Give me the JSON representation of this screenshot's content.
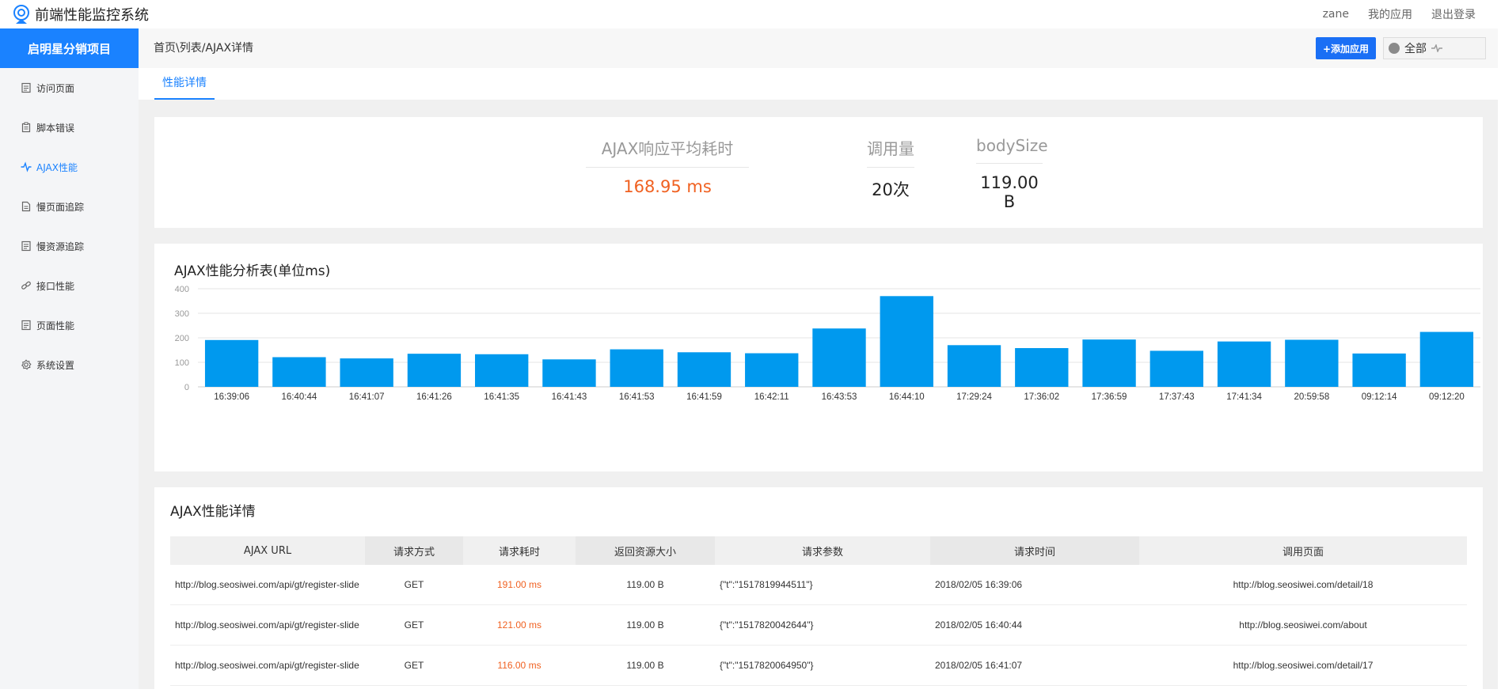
{
  "app": {
    "title": "前端性能监控系统"
  },
  "topnav": {
    "user": "zane",
    "my_apps": "我的应用",
    "logout": "退出登录"
  },
  "sidebar": {
    "project": "启明星分销项目",
    "items": [
      {
        "label": "访问页面",
        "icon": "doc-icon"
      },
      {
        "label": "脚本错误",
        "icon": "clipboard-icon"
      },
      {
        "label": "AJAX性能",
        "icon": "pulse-icon",
        "active": true
      },
      {
        "label": "慢页面追踪",
        "icon": "page-icon"
      },
      {
        "label": "慢资源追踪",
        "icon": "doc-icon"
      },
      {
        "label": "接口性能",
        "icon": "link-icon"
      },
      {
        "label": "页面性能",
        "icon": "doc-icon"
      },
      {
        "label": "系统设置",
        "icon": "gear-icon"
      }
    ]
  },
  "breadcrumb": "首页\\列表/AJAX详情",
  "toolbar": {
    "add_app": "+添加应用",
    "filter": "全部"
  },
  "tabs": [
    {
      "label": "性能详情"
    }
  ],
  "summary": {
    "avg_label": "AJAX响应平均耗时",
    "avg_value": "168.95 ms",
    "calls_label": "调用量",
    "calls_value": "20次",
    "size_label": "bodySize",
    "size_value": "119.00 B"
  },
  "chart_title": "AJAX性能分析表(单位ms)",
  "chart_data": {
    "type": "bar",
    "categories": [
      "16:39:06",
      "16:40:44",
      "16:41:07",
      "16:41:26",
      "16:41:35",
      "16:41:43",
      "16:41:53",
      "16:41:59",
      "16:42:11",
      "16:43:53",
      "16:44:10",
      "17:29:24",
      "17:36:02",
      "17:36:59",
      "17:37:43",
      "17:41:34",
      "20:59:58",
      "09:12:14",
      "09:12:20"
    ],
    "values": [
      191,
      121,
      116,
      135,
      133,
      112,
      153,
      141,
      137,
      238,
      370,
      170,
      158,
      193,
      147,
      185,
      192,
      136,
      224
    ],
    "yticks": [
      0,
      100,
      200,
      300,
      400
    ],
    "ylim": [
      0,
      400
    ],
    "color": "#0099ee",
    "grid": true
  },
  "table": {
    "title": "AJAX性能详情",
    "headers": [
      "AJAX URL",
      "请求方式",
      "请求耗时",
      "返回资源大小",
      "请求参数",
      "请求时间",
      "调用页面"
    ],
    "rows": [
      {
        "url": "http://blog.seosiwei.com/api/gt/register-slide",
        "method": "GET",
        "cost": "191.00 ms",
        "size": "119.00 B",
        "params": "{\"t\":\"1517819944511\"}",
        "time": "2018/02/05 16:39:06",
        "page": "http://blog.seosiwei.com/detail/18"
      },
      {
        "url": "http://blog.seosiwei.com/api/gt/register-slide",
        "method": "GET",
        "cost": "121.00 ms",
        "size": "119.00 B",
        "params": "{\"t\":\"1517820042644\"}",
        "time": "2018/02/05 16:40:44",
        "page": "http://blog.seosiwei.com/about"
      },
      {
        "url": "http://blog.seosiwei.com/api/gt/register-slide",
        "method": "GET",
        "cost": "116.00 ms",
        "size": "119.00 B",
        "params": "{\"t\":\"1517820064950\"}",
        "time": "2018/02/05 16:41:07",
        "page": "http://blog.seosiwei.com/detail/17"
      }
    ]
  }
}
